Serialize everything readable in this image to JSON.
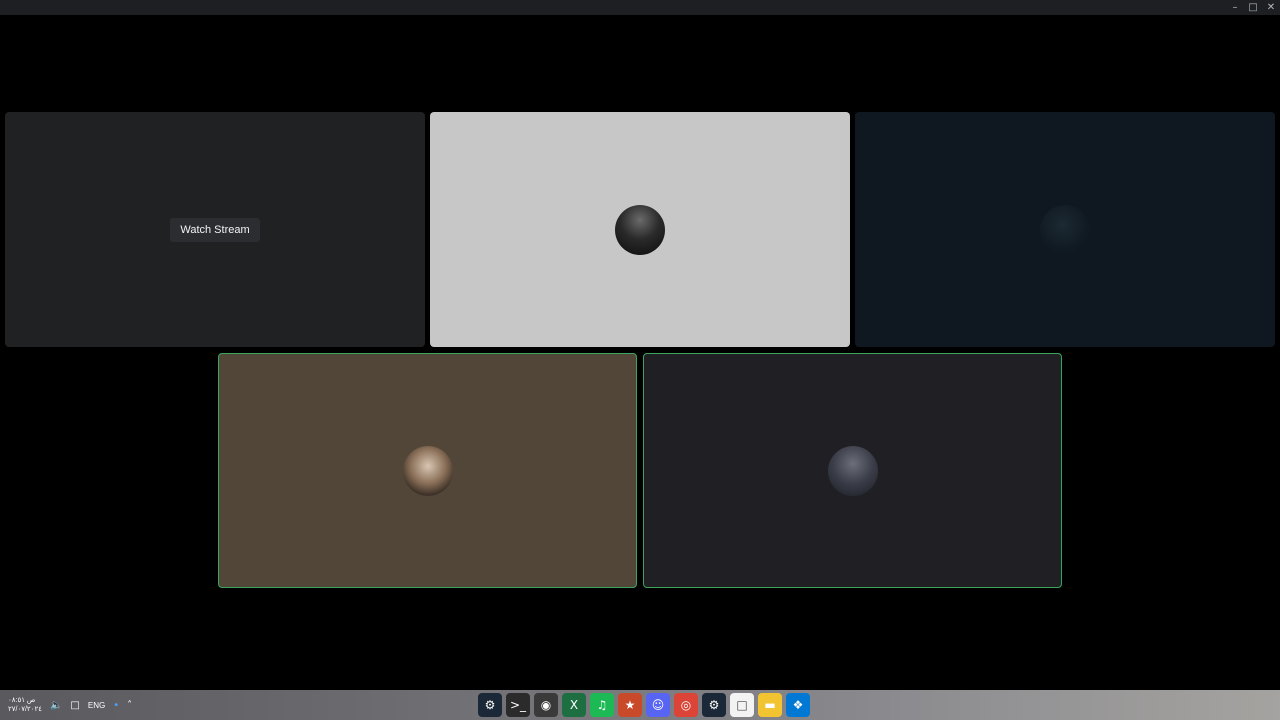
{
  "window": {
    "controls": {
      "minimize": "–",
      "maximize": "□",
      "close": "✕"
    }
  },
  "tiles": [
    {
      "id": "stream",
      "button_label": "Watch Stream",
      "bg": "#202123"
    },
    {
      "id": "user-2",
      "bg": "#c7c7c7",
      "avatar_bg": "#1a1a1a"
    },
    {
      "id": "user-3",
      "bg": "#0f1820",
      "avatar_bg": "#13202a"
    },
    {
      "id": "user-4",
      "bg": "#524638",
      "avatar_bg": "#c9b9a8",
      "speaking": true
    },
    {
      "id": "user-5",
      "bg": "#202024",
      "avatar_bg": "#3a3d48",
      "speaking": true
    }
  ],
  "taskbar": {
    "clock_time": "ص ٠٨:٥١",
    "clock_date": "٢٧/٠٧/٢٠٢٤",
    "language": "ENG",
    "volume_icon": "🔈",
    "display_icon": "□",
    "mic_icon": "•",
    "overflow_icon": "˄",
    "apps": [
      {
        "name": "steam-icon",
        "glyph": "⚙",
        "bg": "#1b2838"
      },
      {
        "name": "terminal-icon",
        "glyph": ">_",
        "bg": "#2b2b2b"
      },
      {
        "name": "obs-icon",
        "glyph": "◉",
        "bg": "#3a3a3a"
      },
      {
        "name": "excel-icon",
        "glyph": "X",
        "bg": "#1d6f42"
      },
      {
        "name": "spotify-icon",
        "glyph": "♫",
        "bg": "#1db954"
      },
      {
        "name": "app-icon",
        "glyph": "★",
        "bg": "#c94a2a"
      },
      {
        "name": "discord-icon",
        "glyph": "☺",
        "bg": "#5865f2"
      },
      {
        "name": "chrome-icon",
        "glyph": "◎",
        "bg": "#db4437"
      },
      {
        "name": "steam-icon-2",
        "glyph": "⚙",
        "bg": "#1b2838"
      },
      {
        "name": "file-icon",
        "glyph": "□",
        "bg": "#f3f3f3"
      },
      {
        "name": "folder-icon",
        "glyph": "▬",
        "bg": "#f3c432"
      },
      {
        "name": "windows-icon",
        "glyph": "❖",
        "bg": "#0078d4"
      }
    ]
  }
}
